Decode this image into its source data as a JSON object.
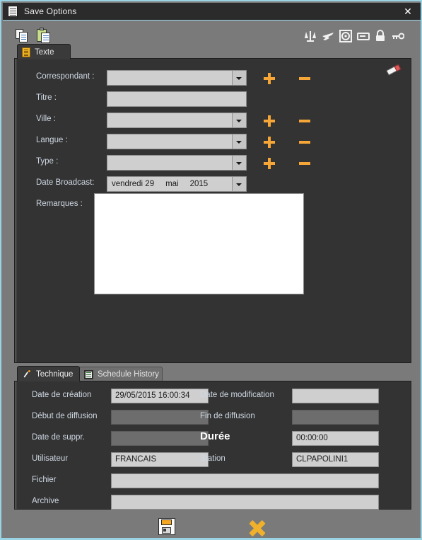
{
  "window": {
    "title": "Save Options",
    "title_icon": "document-icon",
    "close_label": "✕"
  },
  "toolbar": {
    "left_icons": [
      {
        "name": "copy-icon",
        "label": "Copy"
      },
      {
        "name": "paste-icon",
        "label": "Paste"
      }
    ],
    "right_icons": [
      {
        "name": "scales-icon",
        "label": "Scales"
      },
      {
        "name": "plane-icon",
        "label": "Plane"
      },
      {
        "name": "target-icon",
        "label": "Target"
      },
      {
        "name": "card-icon",
        "label": "Card"
      },
      {
        "name": "lock-icon",
        "label": "Lock"
      },
      {
        "name": "key-icon",
        "label": "Key"
      }
    ]
  },
  "top_tab": {
    "icon": "text-document-icon",
    "label": "Texte"
  },
  "main": {
    "eraser_icon": "eraser-icon",
    "fields": [
      {
        "label": "Correspondant :",
        "value": "",
        "type": "combo",
        "add": "+",
        "remove": "−"
      },
      {
        "label": "Titre :",
        "value": "",
        "type": "text"
      },
      {
        "label": "Ville :",
        "value": "",
        "type": "combo",
        "add": "+",
        "remove": "−"
      },
      {
        "label": "Langue :",
        "value": "",
        "type": "combo",
        "add": "+",
        "remove": "−"
      },
      {
        "label": "Type :",
        "value": "",
        "type": "combo",
        "add": "+",
        "remove": "−"
      }
    ],
    "date_broadcast": {
      "label": "Date Broadcast:",
      "value": "vendredi 29     mai     2015",
      "weekday": "vendredi",
      "day": "29",
      "month": "mai",
      "year": "2015"
    },
    "remarques": {
      "label": "Remarques :",
      "value": "",
      "placeholder": ""
    }
  },
  "bottom_tabs": [
    {
      "label": "Technique",
      "icon": "wrench-icon",
      "active": true
    },
    {
      "label": "Schedule History",
      "icon": "history-icon",
      "active": false
    }
  ],
  "technique": {
    "left": [
      {
        "label": "Date de création",
        "value": "29/05/2015 16:00:34",
        "state": "light"
      },
      {
        "label": "Début de diffusion",
        "value": "",
        "state": "dark"
      },
      {
        "label": "Date de suppr.",
        "value": "",
        "state": "dark"
      },
      {
        "label": "Utilisateur",
        "value": "FRANCAIS",
        "state": "light"
      }
    ],
    "right": [
      {
        "label": "Date de modification",
        "value": "",
        "state": "light",
        "big": false
      },
      {
        "label": "Fin de diffusion",
        "value": "",
        "state": "dark",
        "big": false
      },
      {
        "label": "Durée",
        "value": "00:00:00",
        "state": "light",
        "big": true
      },
      {
        "label": "Station",
        "value": "CLPAPOLINI1",
        "state": "light",
        "big": false
      }
    ],
    "wide": [
      {
        "label": "Fichier",
        "value": "",
        "state": "light"
      },
      {
        "label": "Archive",
        "value": "",
        "state": "light"
      }
    ]
  },
  "footer": {
    "save": {
      "name": "save-icon",
      "label": "Save"
    },
    "cancel": {
      "name": "cancel-icon",
      "label": "Cancel"
    }
  },
  "colors": {
    "accent_orange": "#f5a637",
    "window_border": "#9ad4e4",
    "panel_bg": "#333333",
    "chrome_bg": "#7a7a7a",
    "titlebar_bg": "#2b2b2b",
    "field_light": "#cfcfcf",
    "field_dark": "#6d6d6d",
    "label_text": "#cfd8e3"
  }
}
